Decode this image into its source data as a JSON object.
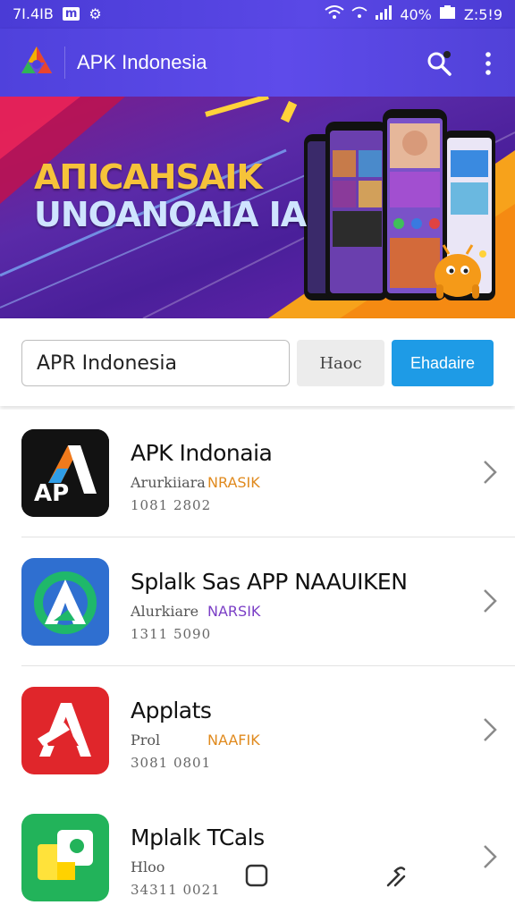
{
  "status_bar": {
    "left_text": "7І.4ІВ",
    "badge": "m",
    "battery": "40%",
    "time": "Z:5!9"
  },
  "app_bar": {
    "title": "APK Indonesia",
    "icons": [
      "app-logo",
      "search-icon",
      "more-vert-icon"
    ]
  },
  "banner": {
    "headline_line1": "AΠICAHSAIK",
    "headline_line2": "UNOANOAIA IA"
  },
  "search": {
    "input_value": "APR Indonesia",
    "secondary_button": "Haoc",
    "primary_button": "Ehadaire"
  },
  "apps": [
    {
      "title": "APK Indonaia",
      "subtitle": "Arurkiiara",
      "badge": "NRASIK",
      "badge_color": "#e08a1e",
      "meta": "1081 2802",
      "icon": "ap-logo-icon",
      "icon_text": "AP"
    },
    {
      "title": "Splalk Sas APP NAAUIKEN",
      "subtitle": "Alurkiare",
      "badge": "NARSIK",
      "badge_color": "#7b3fc6",
      "meta": "1311 5090",
      "icon": "green-a-logo-icon",
      "icon_text": ""
    },
    {
      "title": "Applats",
      "subtitle": "Prol",
      "badge": "NAAFIK",
      "badge_color": "#e08a1e",
      "meta": "3081 0801",
      "icon": "red-a-logo-icon",
      "icon_text": ""
    },
    {
      "title": "Mplalk TCals",
      "subtitle": "Hloo",
      "badge": "",
      "badge_color": "#e08a1e",
      "meta": "34311 0021",
      "icon": "green-puzzle-logo-icon",
      "icon_text": ""
    }
  ],
  "colors": {
    "app_bar": "#5447e0",
    "primary_button": "#1e9be6",
    "banner_orange": "#f7a21b",
    "banner_purple": "#5a2aa8"
  }
}
